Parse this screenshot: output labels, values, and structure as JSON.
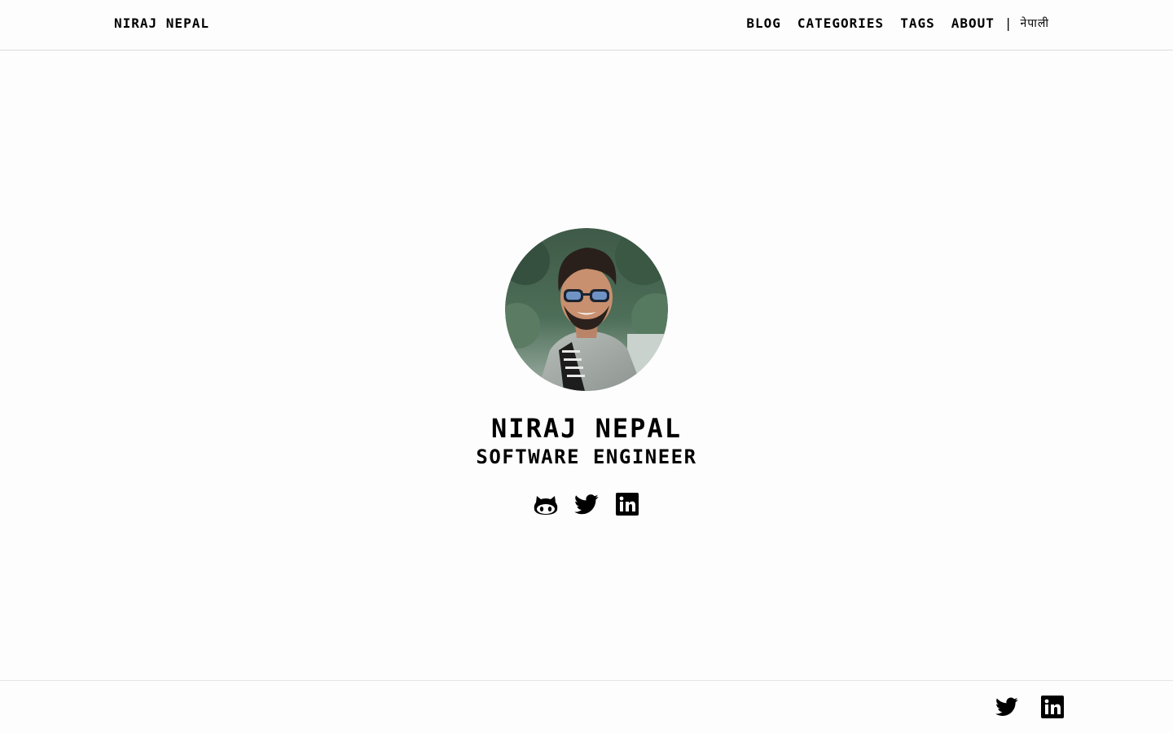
{
  "header": {
    "brand": "NIRAJ NEPAL",
    "nav": [
      {
        "label": "BLOG"
      },
      {
        "label": "CATEGORIES"
      },
      {
        "label": "TAGS"
      },
      {
        "label": "ABOUT"
      }
    ],
    "separator": "|",
    "language": "नेपाली"
  },
  "hero": {
    "name": "NIRAJ NEPAL",
    "role": "SOFTWARE ENGINEER",
    "social": [
      {
        "icon": "github-icon"
      },
      {
        "icon": "twitter-icon"
      },
      {
        "icon": "linkedin-icon"
      }
    ]
  },
  "footer": {
    "social": [
      {
        "icon": "twitter-icon"
      },
      {
        "icon": "linkedin-icon"
      }
    ]
  },
  "colors": {
    "background": "#fdfdfd",
    "text": "#000000",
    "divider": "#dcdcdc"
  }
}
